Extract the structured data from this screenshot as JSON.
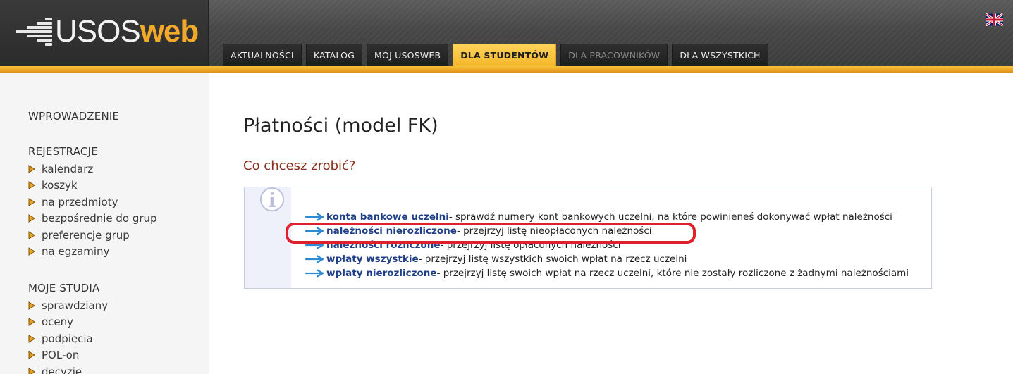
{
  "brand": {
    "logo_usos": "USOS",
    "logo_web": "web"
  },
  "nav": {
    "tabs": [
      {
        "label": "AKTUALNOŚCI",
        "state": "normal"
      },
      {
        "label": "KATALOG",
        "state": "normal"
      },
      {
        "label": "MÓJ USOSWEB",
        "state": "normal"
      },
      {
        "label": "DLA STUDENTÓW",
        "state": "active"
      },
      {
        "label": "DLA PRACOWNIKÓW",
        "state": "disabled"
      },
      {
        "label": "DLA WSZYSTKICH",
        "state": "normal"
      }
    ],
    "language_icon": "uk-flag-icon"
  },
  "sidebar": {
    "sections": [
      {
        "title": "WPROWADZENIE",
        "items": []
      },
      {
        "title": "REJESTRACJE",
        "items": [
          "kalendarz",
          "koszyk",
          "na przedmioty",
          "bezpośrednie do grup",
          "preferencje grup",
          "na egzaminy"
        ]
      },
      {
        "title": "MOJE STUDIA",
        "items": [
          "sprawdziany",
          "oceny",
          "podpięcia",
          "POL-on",
          "decyzje"
        ]
      }
    ]
  },
  "main": {
    "title": "Płatności (model FK)",
    "subheading": "Co chcesz zrobić?",
    "info_icon": "info-icon",
    "links": [
      {
        "label": "konta bankowe uczelni",
        "desc": " - sprawdź numery kont bankowych uczelni, na które powinieneś dokonywać wpłat należności"
      },
      {
        "label": "należności nierozliczone",
        "desc": " - przejrzyj listę nieopłaconych należności"
      },
      {
        "label": "należności rozliczone",
        "desc": " - przejrzyj listę opłaconych należności"
      },
      {
        "label": "wpłaty wszystkie",
        "desc": " - przejrzyj listę wszystkich swoich wpłat na rzecz uczelni"
      },
      {
        "label": "wpłaty nierozliczone",
        "desc": " - przejrzyj listę swoich wpłat na rzecz uczelni, które nie zostały rozliczone z żadnymi należnościami"
      }
    ]
  },
  "colors": {
    "accent": "#f5b82c",
    "link": "#1f3f88",
    "subheading": "#8a2d1c",
    "highlight": "#e0202a"
  }
}
